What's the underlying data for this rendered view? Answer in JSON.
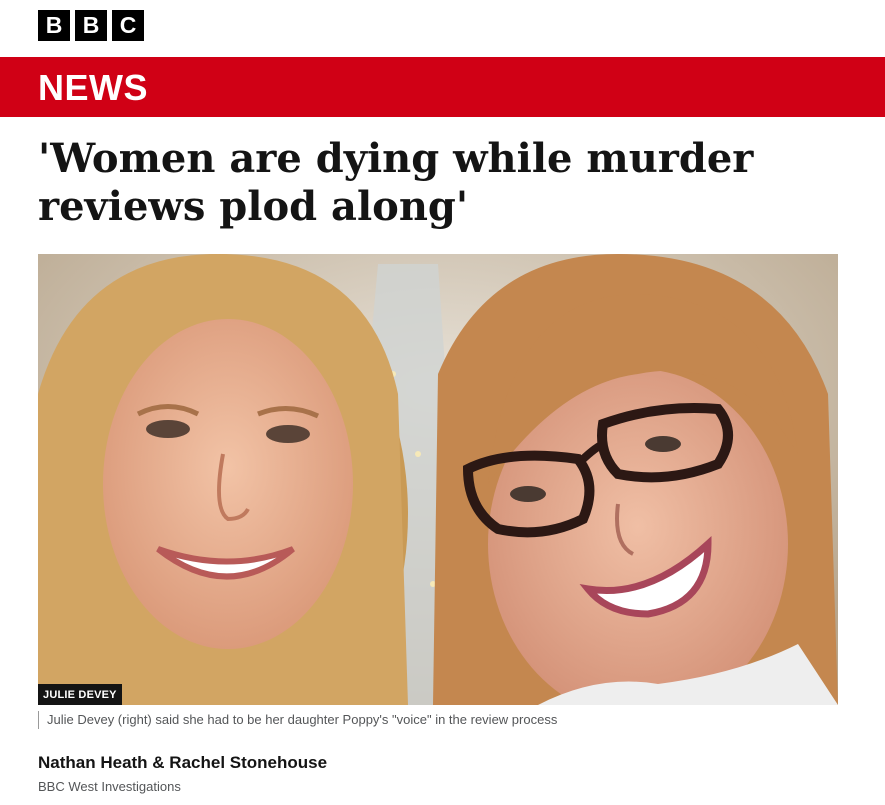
{
  "masthead": {
    "logo_letters": [
      "B",
      "B",
      "C"
    ]
  },
  "newsbar": {
    "label": "NEWS",
    "color": "#d00015"
  },
  "article": {
    "headline": "'Women are dying while murder reviews plod along'",
    "image": {
      "credit": "JULIE DEVEY",
      "caption": "Julie Devey (right) said she had to be her daughter Poppy's \"voice\" in the review process"
    },
    "byline": {
      "authors": "Nathan Heath & Rachel Stonehouse",
      "department": "BBC West Investigations"
    }
  }
}
